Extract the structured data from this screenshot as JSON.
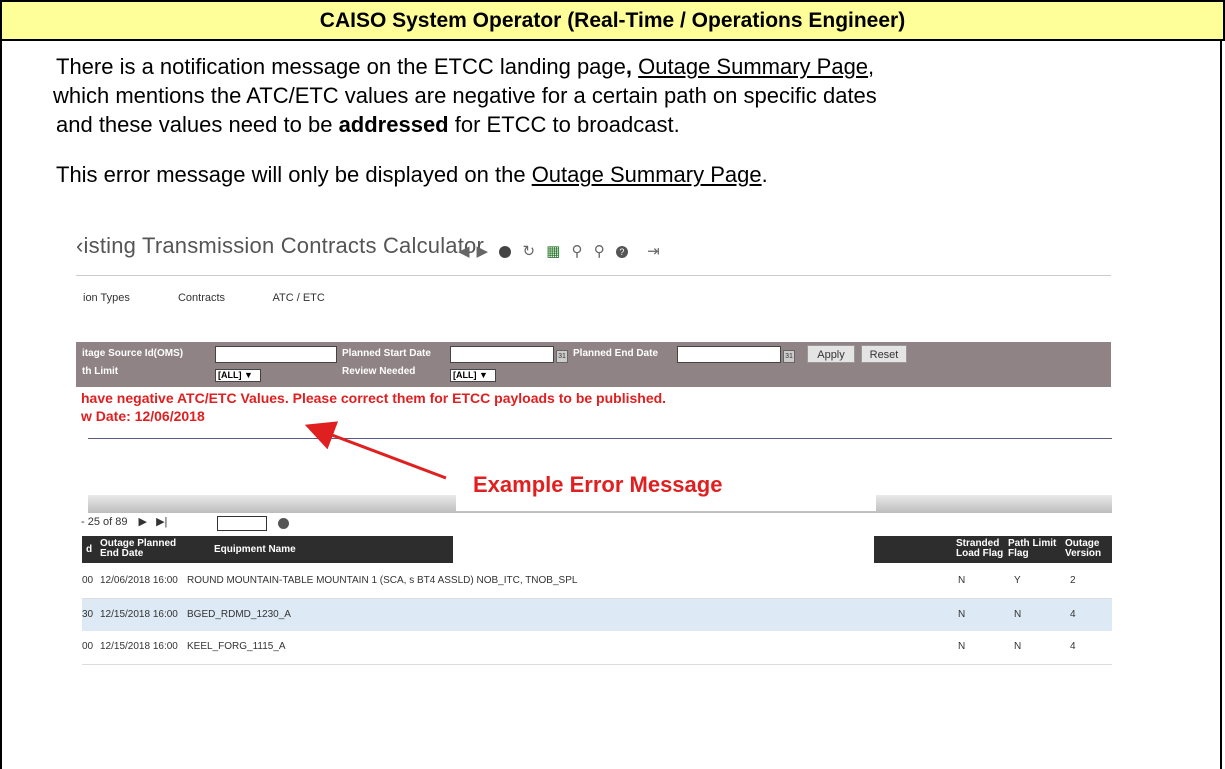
{
  "header": {
    "title": "CAISO System Operator (Real-Time / Operations Engineer)"
  },
  "para1": {
    "line1_a": "There is a notification message on the ETCC landing page",
    "line1_comma": ",",
    "line1_link": "Outage Summary Page",
    "line1_b": ",",
    "line2": "which mentions the ATC/ETC values are negative for a certain path on specific dates",
    "line3_a": "and these values need to be ",
    "line3_bold": "addressed",
    "line3_b": " for ETCC to broadcast."
  },
  "para2": {
    "a": "This error message will only be displayed on the ",
    "link": "Outage Summary Page",
    "b": "."
  },
  "app": {
    "title": "‹isting Transmission Contracts Calculator",
    "nav": [
      "ion Types",
      "Contracts",
      "ATC / ETC"
    ],
    "filters": {
      "outage_source_label": "itage Source Id(OMS)",
      "path_limit_label": "th Limit",
      "planned_start_label": "Planned Start Date",
      "review_needed_label": "Review Needed",
      "planned_end_label": "Planned End Date",
      "select_all": "[ALL]",
      "apply": "Apply",
      "reset": "Reset"
    },
    "error_line1": "have negative ATC/ETC Values. Please correct them for ETCC payloads to be published.",
    "error_line2": "w Date: 12/06/2018",
    "annotation": "Example Error Message",
    "pager": {
      "text": "- 25  of  89"
    },
    "columns": {
      "c0": "d",
      "c1a": "Outage Planned",
      "c1b": "End Date",
      "c2": "Equipment Name",
      "c3a": "Stranded",
      "c3b": "Load Flag",
      "c4a": "Path Limit",
      "c4b": "Flag",
      "c5a": "Outage",
      "c5b": "Version"
    },
    "rows": [
      {
        "c0": "00",
        "end": "12/06/2018 16:00",
        "equipment": "ROUND MOUNTAIN-TABLE MOUNTAIN 1 (SCA, s BT4 ASSLD)    NOB_ITC, TNOB_SPL",
        "stranded": "N",
        "path": "Y",
        "version": "2"
      },
      {
        "c0": "30",
        "end": "12/15/2018 16:00",
        "equipment": "BGED_RDMD_1230_A",
        "stranded": "N",
        "path": "N",
        "version": "4"
      },
      {
        "c0": "00",
        "end": "12/15/2018 16:00",
        "equipment": "KEEL_FORG_1115_A",
        "stranded": "N",
        "path": "N",
        "version": "4"
      }
    ]
  }
}
